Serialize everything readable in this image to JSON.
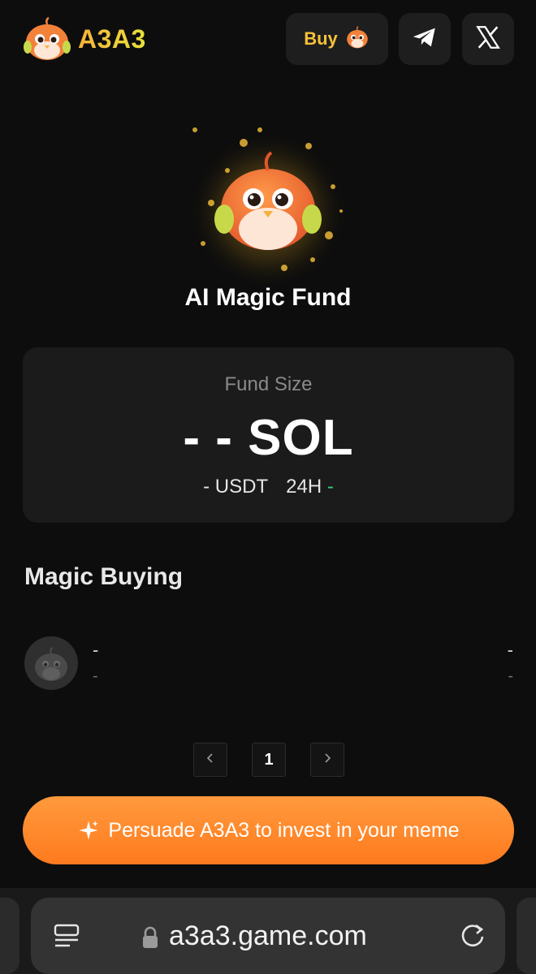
{
  "header": {
    "brand": "A3A3",
    "buy_label": "Buy"
  },
  "hero": {
    "title": "AI Magic Fund"
  },
  "fund": {
    "label": "Fund Size",
    "value": "- - SOL",
    "usdt": "- USDT",
    "change_label": "24H",
    "change_value": "-"
  },
  "magic_buying": {
    "title": "Magic Buying",
    "rows": [
      {
        "name": "-",
        "sub": "-",
        "amount": "-",
        "time": "-"
      }
    ]
  },
  "pagination": {
    "current_page": "1"
  },
  "cta": {
    "label": "Persuade A3A3 to invest in your meme"
  },
  "browser": {
    "url": "a3a3.game.com"
  },
  "colors": {
    "background": "#0d0d0d",
    "card": "#1b1b1b",
    "accent_orange": "#ff8a2a",
    "positive_green": "#33d17a",
    "brand_yellow": "#f6c13a"
  }
}
